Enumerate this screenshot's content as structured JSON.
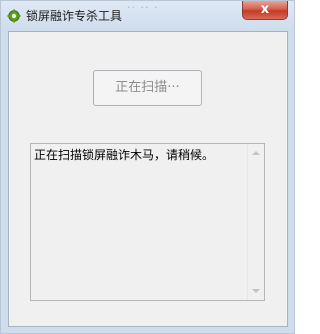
{
  "window": {
    "title": "锁屏融诈专杀工具",
    "close_label": "x",
    "icon": "app-gear-icon",
    "titlebar_ghost_text": "·· ·· ·"
  },
  "main": {
    "scan_button_label": "正在扫描···",
    "log_text": "正在扫描锁屏融诈木马，请稍候。"
  },
  "colors": {
    "close_button": "#c33a28",
    "title_bar": "#dfe9f5",
    "client_bg": "#f0f0f0",
    "disabled_text": "#8d8d8d"
  }
}
